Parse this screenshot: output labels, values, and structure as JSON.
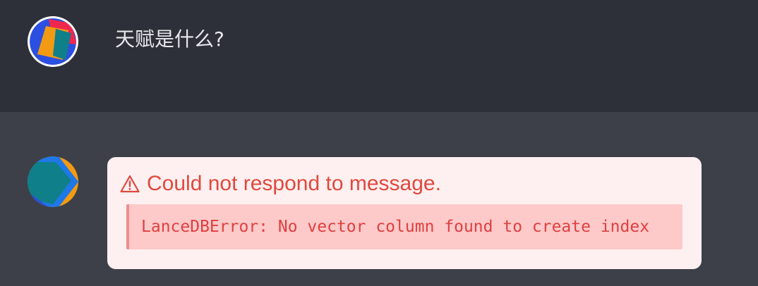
{
  "user_message": {
    "text": "天赋是什么?"
  },
  "assistant_message": {
    "error_title": "Could not respond to message.",
    "error_detail": "LanceDBError: No vector column found to create index"
  },
  "colors": {
    "user_row_bg": "#2d3038",
    "assistant_row_bg": "#3d4048",
    "error_card_bg": "#fef0f0",
    "error_text": "#e0483e",
    "error_detail_bg": "#fdc9c9"
  },
  "icons": {
    "user_avatar": "user-avatar-icon",
    "assistant_avatar": "assistant-avatar-icon",
    "warning": "warning-triangle-icon"
  }
}
